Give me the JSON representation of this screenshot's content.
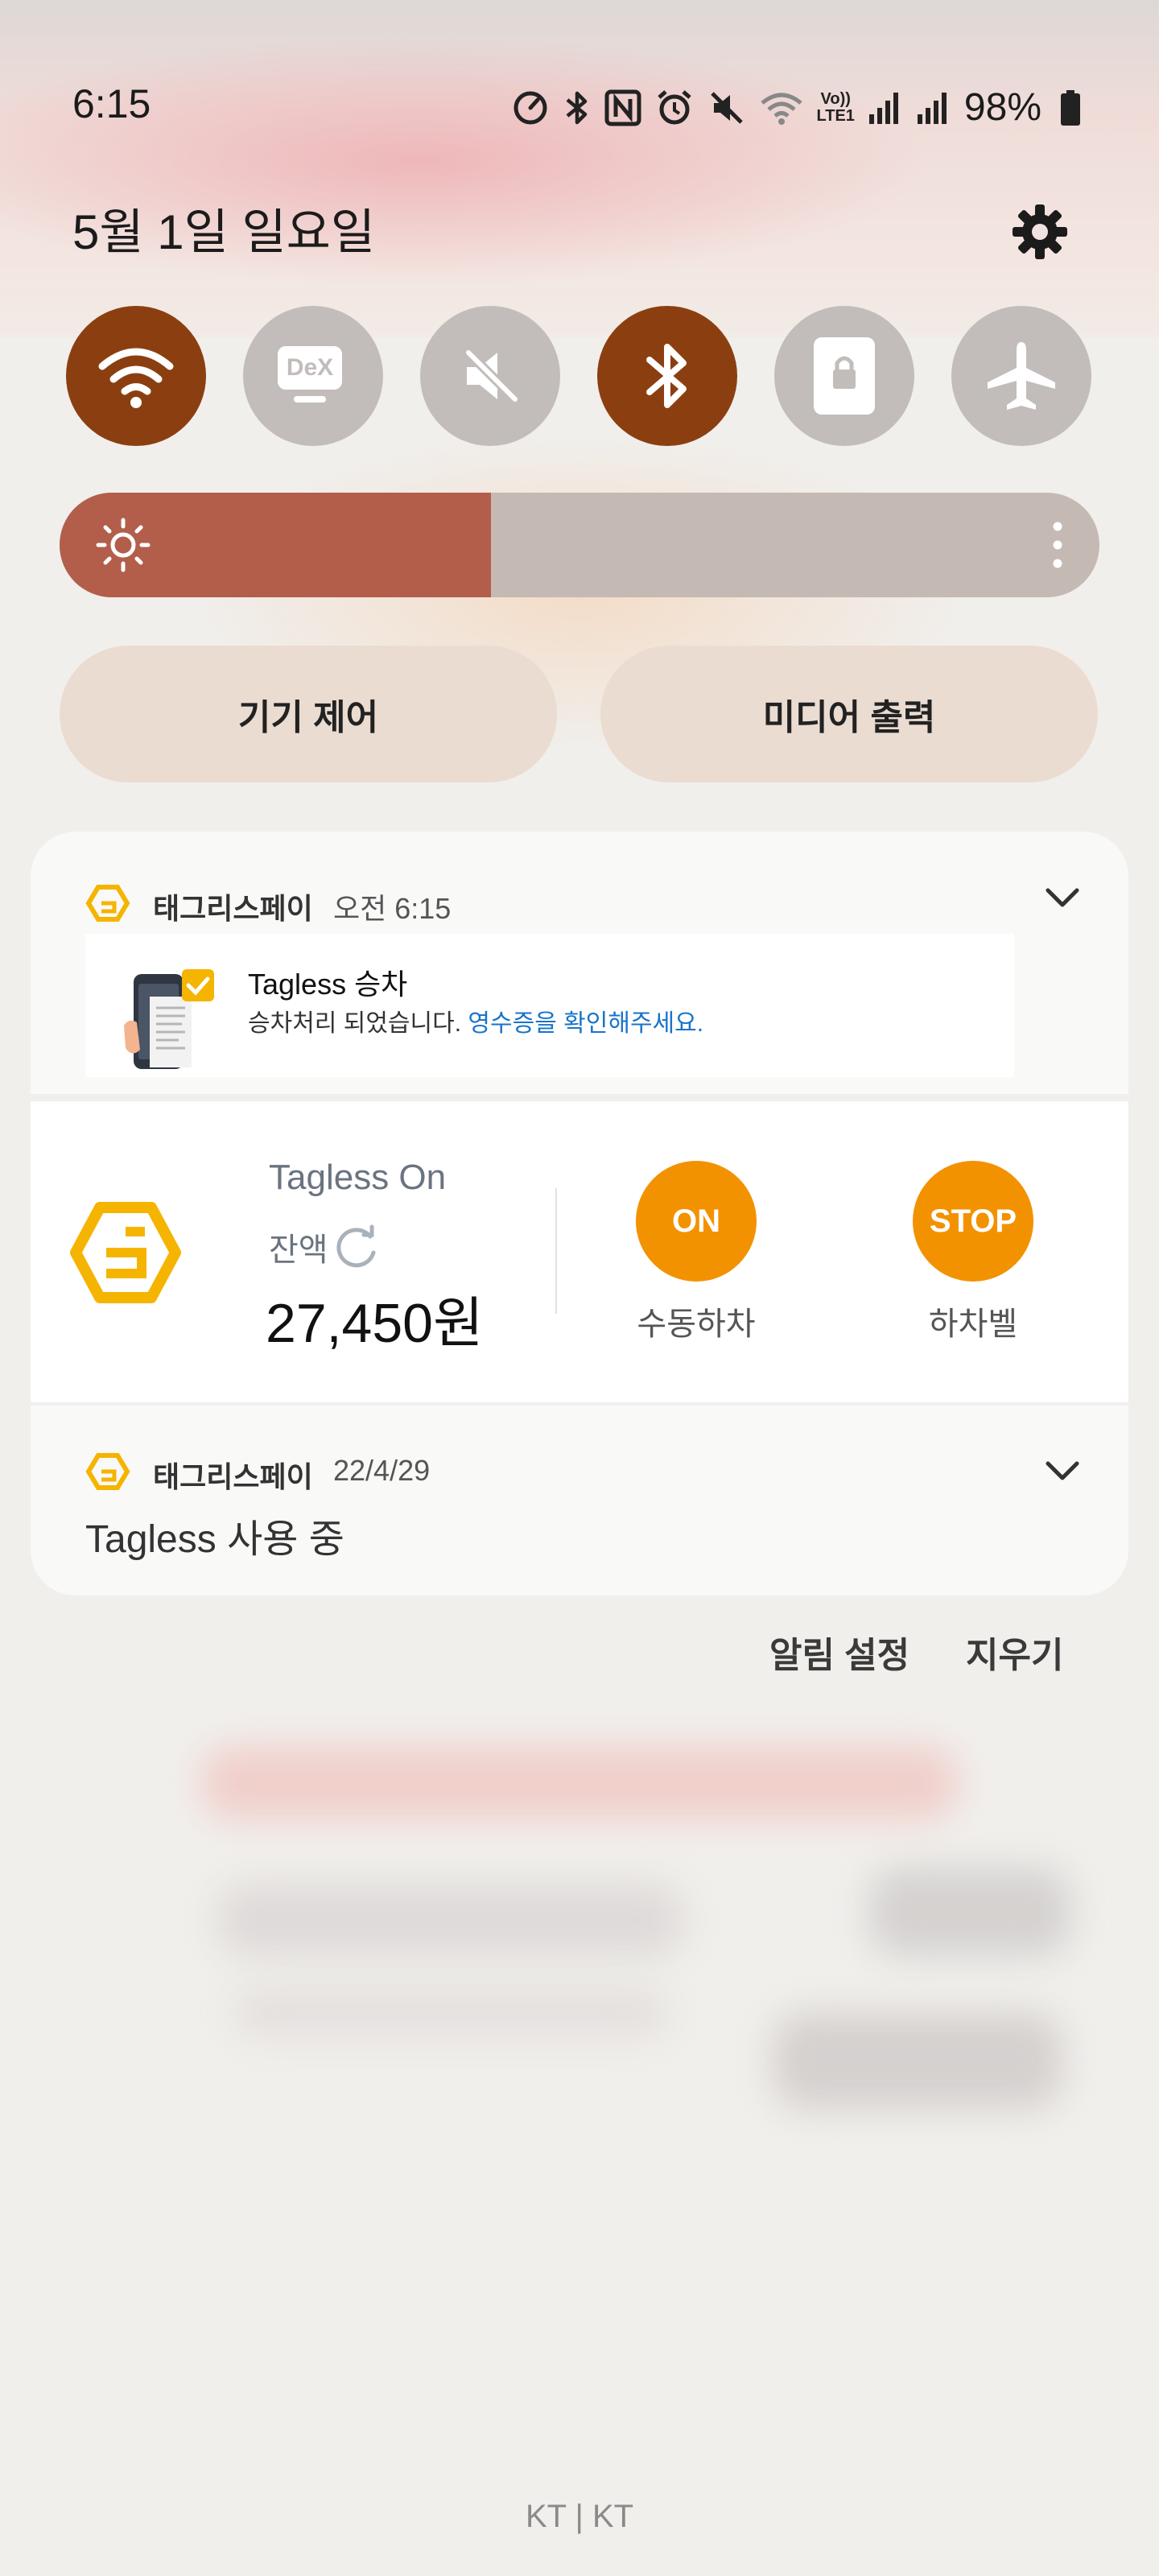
{
  "status_bar": {
    "time": "6:15",
    "battery_percent": "98%",
    "network_label_top": "Vo))",
    "network_label_bottom": "LTE1",
    "icons": [
      "speedometer-icon",
      "bluetooth-icon",
      "nfc-icon",
      "alarm-icon",
      "mute-icon",
      "wifi-icon",
      "signal-icon",
      "signal-icon",
      "battery-icon"
    ]
  },
  "header": {
    "date": "5월 1일 일요일",
    "settings_icon": "gear-icon"
  },
  "quick_settings": {
    "tiles": [
      {
        "name": "wifi",
        "icon": "wifi-icon",
        "active": true
      },
      {
        "name": "dex",
        "label": "DeX",
        "icon": "dex-icon",
        "active": false
      },
      {
        "name": "sound",
        "icon": "mute-icon",
        "active": false
      },
      {
        "name": "bluetooth",
        "icon": "bluetooth-icon",
        "active": true
      },
      {
        "name": "lock-screen",
        "icon": "lock-icon",
        "active": false
      },
      {
        "name": "airplane",
        "icon": "airplane-icon",
        "active": false
      }
    ],
    "brightness_level": 0.415,
    "device_control_label": "기기 제어",
    "media_output_label": "미디어 출력"
  },
  "notifications": {
    "first": {
      "app_name": "태그리스페이",
      "time": "오전 6:15",
      "title": "Tagless 승차",
      "body": "승차처리 되었습니다.",
      "body_link": "영수증을 확인해주세요."
    },
    "widget": {
      "title": "Tagless On",
      "balance_label": "잔액",
      "balance": "27,450원",
      "on_button": "ON",
      "on_caption": "수동하차",
      "stop_button": "STOP",
      "stop_caption": "하차벨"
    },
    "second": {
      "app_name": "태그리스페이",
      "time": "22/4/29",
      "text": "Tagless 사용 중"
    }
  },
  "actions": {
    "notification_settings": "알림 설정",
    "clear": "지우기"
  },
  "footer": {
    "carrier": "KT | KT"
  },
  "colors": {
    "accent_brown": "#8b3f10",
    "brightness_fill": "#b25e4b",
    "tagless_orange": "#f39200",
    "tagless_yellow": "#f5b400",
    "link_blue": "#1a73c9"
  }
}
